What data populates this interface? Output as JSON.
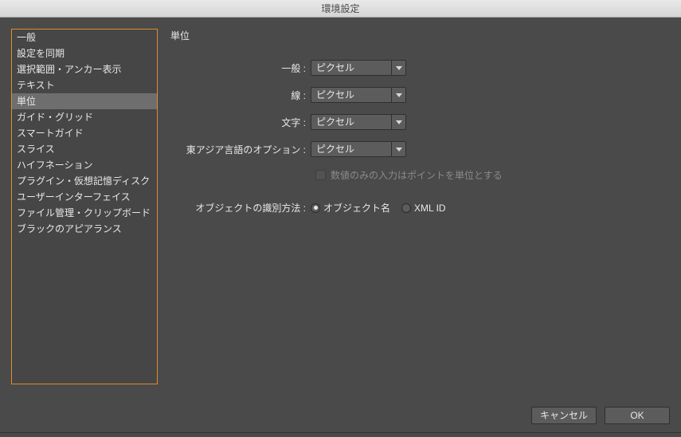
{
  "window": {
    "title": "環境設定"
  },
  "sidebar": {
    "items": [
      {
        "label": "一般"
      },
      {
        "label": "設定を同期"
      },
      {
        "label": "選択範囲・アンカー表示"
      },
      {
        "label": "テキスト"
      },
      {
        "label": "単位",
        "selected": true
      },
      {
        "label": "ガイド・グリッド"
      },
      {
        "label": "スマートガイド"
      },
      {
        "label": "スライス"
      },
      {
        "label": "ハイフネーション"
      },
      {
        "label": "プラグイン・仮想記憶ディスク"
      },
      {
        "label": "ユーザーインターフェイス"
      },
      {
        "label": "ファイル管理・クリップボード"
      },
      {
        "label": "ブラックのアピアランス"
      }
    ]
  },
  "main": {
    "section_title": "単位",
    "rows": {
      "general": {
        "label": "一般 :",
        "value": "ピクセル"
      },
      "stroke": {
        "label": "線 :",
        "value": "ピクセル"
      },
      "type": {
        "label": "文字 :",
        "value": "ピクセル"
      },
      "easttype": {
        "label": "東アジア言語のオプション :",
        "value": "ピクセル"
      }
    },
    "checkbox": {
      "label": "数値のみの入力はポイントを単位とする",
      "checked": false,
      "enabled": false
    },
    "radio": {
      "lead": "オブジェクトの識別方法 :",
      "options": [
        {
          "label": "オブジェクト名",
          "checked": true
        },
        {
          "label": "XML ID",
          "checked": false
        }
      ]
    }
  },
  "footer": {
    "cancel": "キャンセル",
    "ok": "OK"
  }
}
